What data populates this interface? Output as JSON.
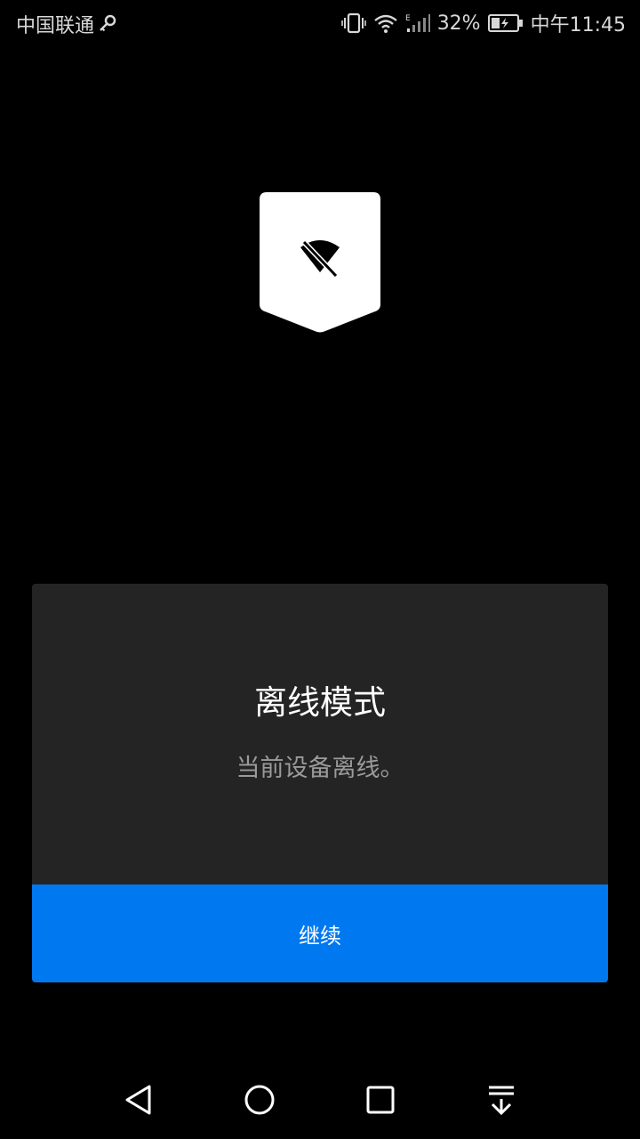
{
  "status_bar": {
    "carrier": "中国联通",
    "battery_percent": "32%",
    "time": "中午11:45",
    "icons": [
      "key-icon",
      "vibrate-icon",
      "wifi-icon",
      "signal-icon",
      "battery-charging-icon"
    ]
  },
  "badge": {
    "icon": "wifi-off-icon"
  },
  "dialog": {
    "title": "离线模式",
    "message": "当前设备离线。",
    "continue_label": "继续"
  },
  "nav_bar": {
    "icons": [
      "back-icon",
      "home-icon",
      "recents-icon",
      "notification-pull-icon"
    ]
  },
  "colors": {
    "background": "#000000",
    "dialog_bg": "#242424",
    "accent": "#0078f0",
    "muted_text": "#9a9a9a"
  }
}
